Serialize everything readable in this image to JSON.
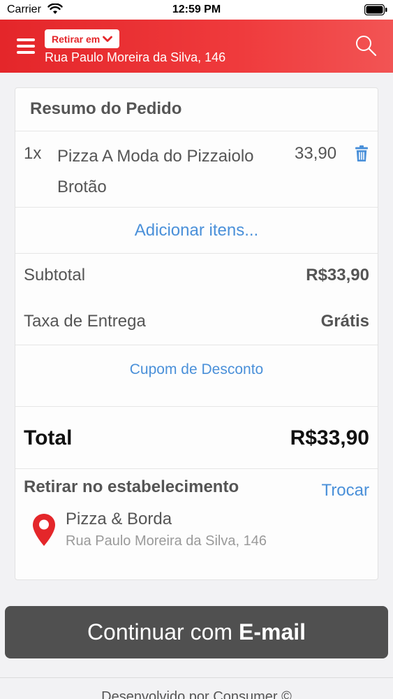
{
  "status_bar": {
    "carrier": "Carrier",
    "time": "12:59 PM"
  },
  "header": {
    "pickup_label": "Retirar em",
    "address": "Rua Paulo Moreira da Silva, 146",
    "accent_color": "#e4262a"
  },
  "order": {
    "title": "Resumo do Pedido",
    "items": [
      {
        "qty": "1x",
        "name": "Pizza A Moda do Pizzaiolo Brotão",
        "price": "33,90"
      }
    ],
    "add_items": "Adicionar itens...",
    "subtotal_label": "Subtotal",
    "subtotal_value": "R$33,90",
    "delivery_label": "Taxa de Entrega",
    "delivery_value": "Grátis",
    "coupon": "Cupom de Desconto",
    "total_label": "Total",
    "total_value": "R$33,90"
  },
  "pickup": {
    "heading": "Retirar no estabelecimento",
    "change": "Trocar",
    "store_name": "Pizza & Borda",
    "store_address": "Rua Paulo Moreira da Silva, 146"
  },
  "continue": {
    "prefix": "Continuar com",
    "method": "E-mail"
  },
  "footer": {
    "text": "Desenvolvido por Consumer ©"
  },
  "icons": [
    "wifi-icon",
    "battery-icon",
    "menu-icon",
    "chevron-down-icon",
    "search-icon",
    "trash-icon",
    "location-pin-icon"
  ]
}
